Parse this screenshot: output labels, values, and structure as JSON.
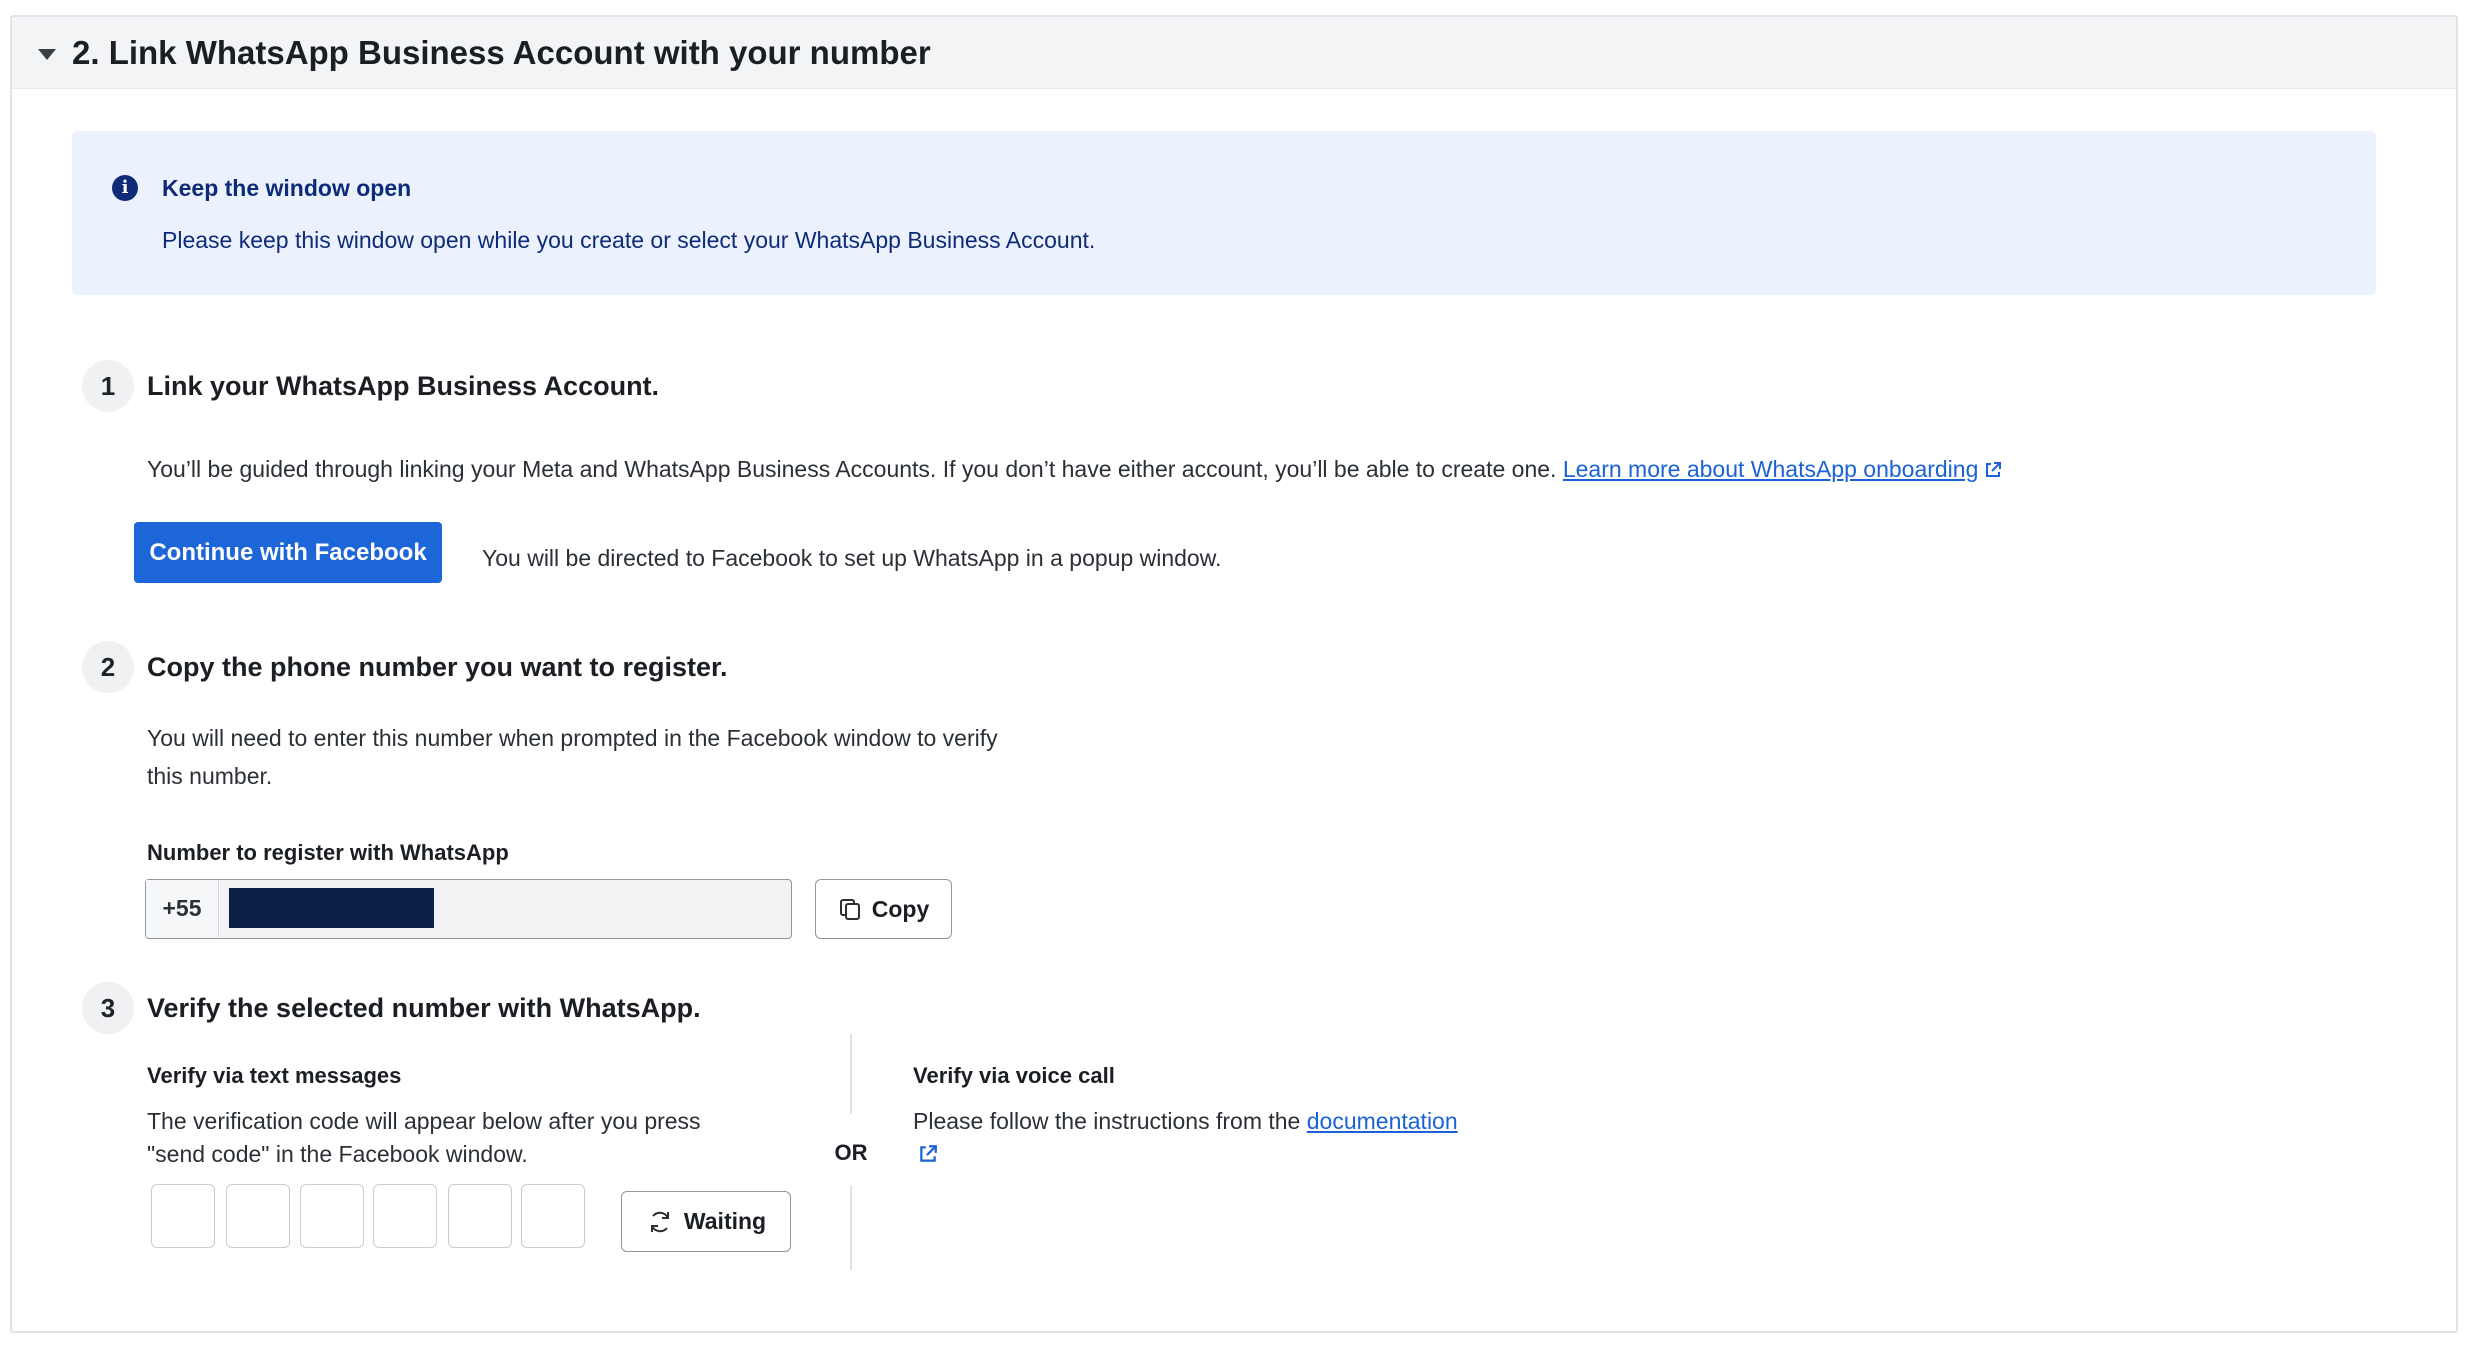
{
  "section": {
    "title": "2. Link WhatsApp Business Account with your number"
  },
  "alert": {
    "icon": "info-icon",
    "title": "Keep the window open",
    "text": "Please keep this window open while you create or select your WhatsApp Business Account."
  },
  "steps": [
    {
      "number": "1",
      "title": "Link your WhatsApp Business Account.",
      "description": "You’ll be guided through linking your Meta and WhatsApp Business Accounts. If you don’t have either account, you’ll be able to create one.",
      "link_text": "Learn more about WhatsApp onboarding",
      "button_label": "Continue with Facebook",
      "button_hint": "You will be directed to Facebook to set up WhatsApp in a popup window."
    },
    {
      "number": "2",
      "title": "Copy the phone number you want to register.",
      "description_line1": "You will need to enter this number when prompted in the Facebook window to verify",
      "description_line2": "this number.",
      "field_label": "Number to register with WhatsApp",
      "country_code": "+55",
      "copy_label": "Copy"
    },
    {
      "number": "3",
      "title": "Verify the selected number with WhatsApp.",
      "text_option": {
        "title": "Verify via text messages",
        "line1": "The verification code will appear below after you press",
        "line2": "\"send code\" in the Facebook window.",
        "code_boxes": [
          "",
          "",
          "",
          "",
          "",
          ""
        ],
        "waiting_label": "Waiting"
      },
      "or_label": "OR",
      "voice_option": {
        "title": "Verify via voice call",
        "text": "Please follow the instructions from the",
        "link_text": "documentation"
      }
    }
  ],
  "colors": {
    "primary": "#1c66d9",
    "alert_bg": "#ebf2fd",
    "alert_text": "#0e2b7a",
    "link": "#1a62d6"
  }
}
